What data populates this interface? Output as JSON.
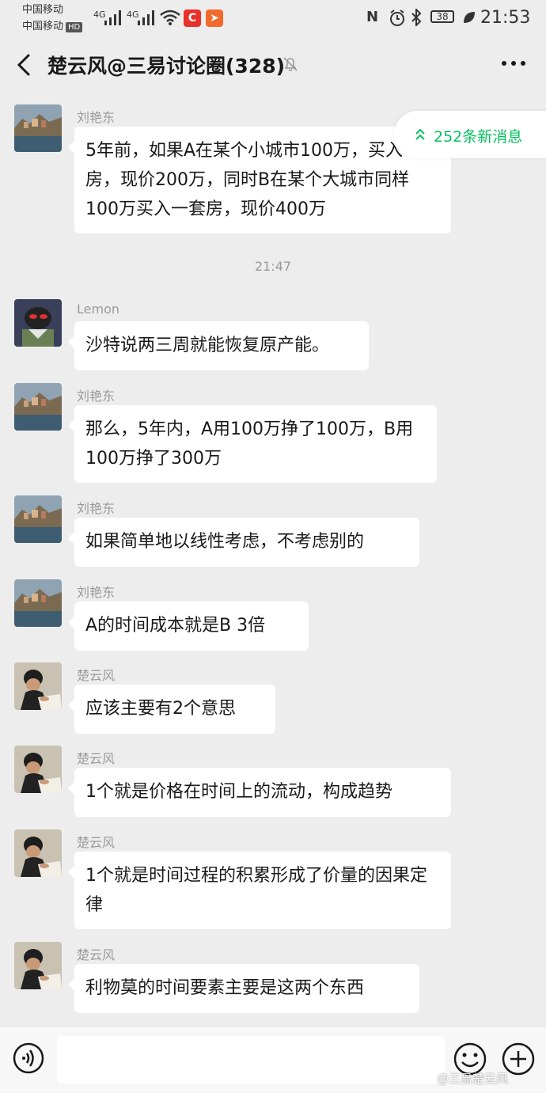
{
  "status_bar": {
    "carrier1": "中国移动",
    "carrier2": "中国移动",
    "hd": "HD",
    "network1": "4G",
    "network2": "4G",
    "battery": "38",
    "time": "21:53",
    "app_icon_1": "C"
  },
  "header": {
    "title": "楚云风@三易讨论圈(328)",
    "icons": [
      "back-arrow-icon",
      "mute-bell-icon",
      "more-icon"
    ]
  },
  "new_messages": "252条新消息",
  "messages": [
    {
      "sender": "刘艳东",
      "text": "5年前，如果A在某个小城市100万，买入一套房，现价200万，同时B在某个大城市同样100万买入一套房，现价400万"
    },
    {
      "timestamp": "21:47"
    },
    {
      "sender": "Lemon",
      "text": "沙特说两三周就能恢复原产能。"
    },
    {
      "sender": "刘艳东",
      "text": "那么，5年内，A用100万挣了100万，B用100万挣了300万"
    },
    {
      "sender": "刘艳东",
      "text": "如果简单地以线性考虑，不考虑别的"
    },
    {
      "sender": "刘艳东",
      "text": "A的时间成本就是B 3倍"
    },
    {
      "sender": "楚云风",
      "text": "应该主要有2个意思"
    },
    {
      "sender": "楚云风",
      "text": "1个就是价格在时间上的流动，构成趋势"
    },
    {
      "sender": "楚云风",
      "text": "1个就是时间过程的积累形成了价量的因果定律"
    },
    {
      "sender": "楚云风",
      "text": "利物莫的时间要素主要是这两个东西"
    }
  ],
  "input_bar": {
    "icons": [
      "voice-icon",
      "emoji-icon",
      "plus-icon"
    ]
  },
  "watermark": "@三易楚云风",
  "colors": {
    "accent": "#07c160",
    "background": "#ededed",
    "bubble": "#ffffff"
  }
}
